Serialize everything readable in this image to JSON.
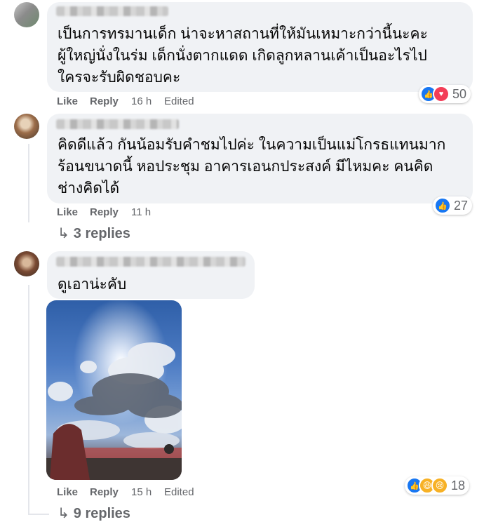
{
  "comments": [
    {
      "text_lines": [
        "เป็นการทรมานเด็ก น่าจะหาสถานที่ให้มันเหมาะกว่านี้นะคะ",
        "ผู้ใหญ่นั่งในร่ม เด็กนั่งตากแดด เกิดลูกหลานเค้าเป็นอะไรไป",
        "ใครจะรับผิดชอบคะ"
      ],
      "like": "Like",
      "reply": "Reply",
      "time": "16 h",
      "edited": "Edited",
      "reaction_icons": [
        "like-icon",
        "love-icon"
      ],
      "reaction_count": "50"
    },
    {
      "text_lines": [
        "คิดดีแล้ว กันน้อมรับคำชมไปค่ะ ในความเป็นแม่โกรธแทนมาก",
        "ร้อนขนาดนี้ หอประชุม อาคารเอนกประสงค์ มีไหมคะ คนคิด",
        "ช่างคิดได้"
      ],
      "like": "Like",
      "reply": "Reply",
      "time": "11 h",
      "reaction_icons": [
        "like-icon"
      ],
      "reaction_count": "27",
      "replies": "3 replies"
    },
    {
      "text_lines": [
        "ดูเอาน่ะคับ"
      ],
      "like": "Like",
      "reply": "Reply",
      "time": "15 h",
      "edited": "Edited",
      "reaction_icons": [
        "like-icon",
        "haha-icon",
        "sad-icon"
      ],
      "reaction_count": "18",
      "replies": "9 replies"
    }
  ],
  "colors": {
    "bubble": "#f0f2f5",
    "meta_text": "#65676b",
    "like_blue": "#1877f2",
    "love_red": "#f33e58",
    "emoji_yellow": "#f7b125"
  }
}
